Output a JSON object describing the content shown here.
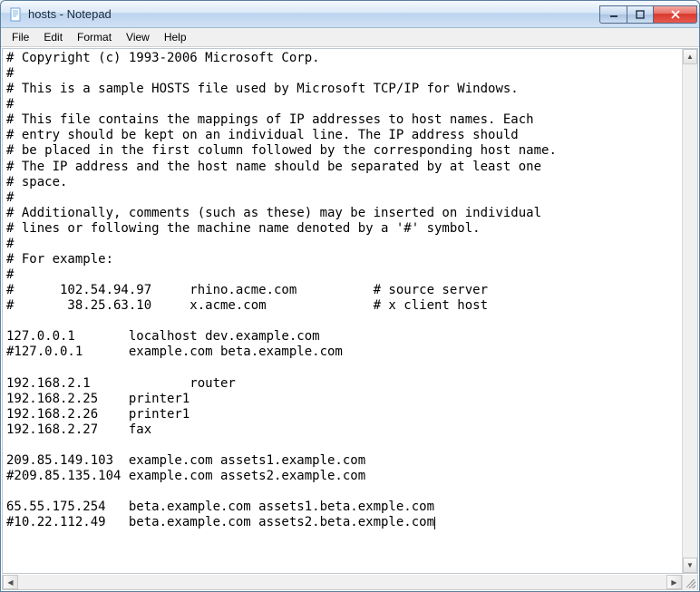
{
  "window": {
    "title": "hosts - Notepad"
  },
  "menubar": {
    "items": [
      "File",
      "Edit",
      "Format",
      "View",
      "Help"
    ]
  },
  "editor": {
    "content": "# Copyright (c) 1993-2006 Microsoft Corp.\n#\n# This is a sample HOSTS file used by Microsoft TCP/IP for Windows.\n#\n# This file contains the mappings of IP addresses to host names. Each\n# entry should be kept on an individual line. The IP address should\n# be placed in the first column followed by the corresponding host name.\n# The IP address and the host name should be separated by at least one\n# space.\n#\n# Additionally, comments (such as these) may be inserted on individual\n# lines or following the machine name denoted by a '#' symbol.\n#\n# For example:\n#\n#      102.54.94.97     rhino.acme.com          # source server\n#       38.25.63.10     x.acme.com              # x client host\n\n127.0.0.1       localhost dev.example.com\n#127.0.0.1      example.com beta.example.com\n\n192.168.2.1             router\n192.168.2.25    printer1\n192.168.2.26    printer1\n192.168.2.27    fax\n\n209.85.149.103  example.com assets1.example.com\n#209.85.135.104 example.com assets2.example.com\n\n65.55.175.254   beta.example.com assets1.beta.exmple.com\n#10.22.112.49   beta.example.com assets2.beta.exmple.com"
  }
}
